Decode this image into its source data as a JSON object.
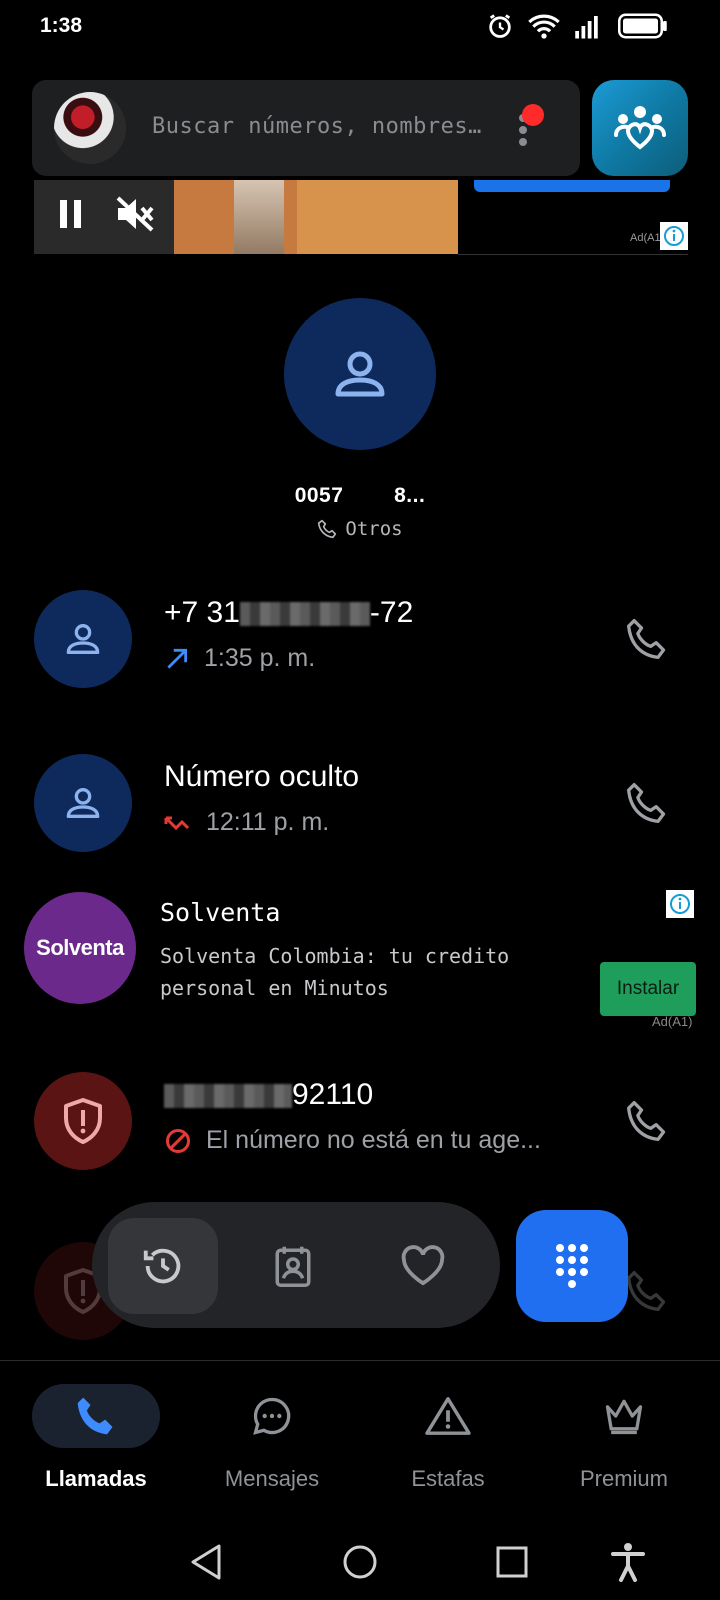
{
  "status_bar": {
    "time": "1:38"
  },
  "search": {
    "placeholder": "Buscar números, nombres y ..."
  },
  "top_ad": {
    "tag": "Ad(A1)"
  },
  "contact": {
    "number": "0057        8...",
    "type_label": "Otros"
  },
  "calls": [
    {
      "title_prefix": "+7 31",
      "title_suffix": "-72",
      "time": "1:35 p. m.",
      "direction": "outgoing"
    },
    {
      "title": "Número oculto",
      "time": "12:11 p. m.",
      "direction": "missed"
    },
    {
      "title_suffix": "92110",
      "subtitle": "El número no está en tu age...",
      "direction": "blocked"
    }
  ],
  "ad_row": {
    "logo_text": "Solventa",
    "title": "Solventa",
    "description": "Solventa Colombia: tu credito personal en Minutos",
    "install_label": "Instalar",
    "tag": "Ad(A1)"
  },
  "bottom_nav": {
    "items": [
      {
        "label": "Llamadas",
        "icon": "phone-icon",
        "active": true
      },
      {
        "label": "Mensajes",
        "icon": "chat-bubble-icon"
      },
      {
        "label": "Estafas",
        "icon": "warning-icon"
      },
      {
        "label": "Premium",
        "icon": "crown-icon"
      }
    ]
  },
  "colors": {
    "accent": "#1f6ff0",
    "avatar_blue": "#0e2a5c",
    "avatar_red": "#5a1414",
    "install_green": "#1e9e5a",
    "missed_red": "#e53935"
  }
}
